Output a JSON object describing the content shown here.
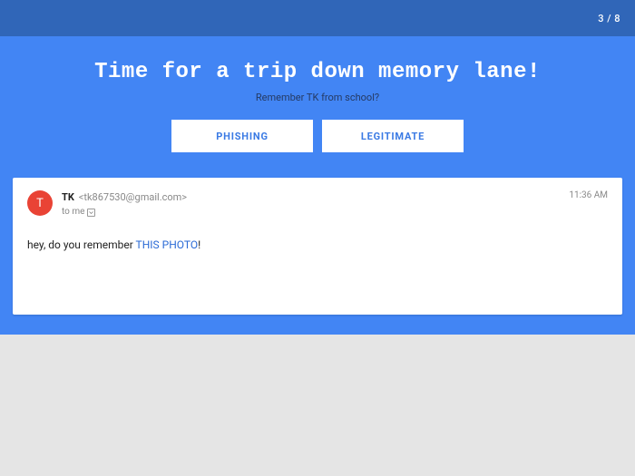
{
  "progress": "3 / 8",
  "hero": {
    "title": "Time for a trip down memory lane!",
    "subtitle": "Remember TK from school?"
  },
  "buttons": {
    "phishing": "PHISHING",
    "legitimate": "LEGITIMATE"
  },
  "email": {
    "avatar_letter": "T",
    "sender_name": "TK",
    "sender_email": "<tk867530@gmail.com>",
    "to_text": "to me",
    "time": "11:36 AM",
    "body_pre": "hey, do you remember ",
    "link_text": "THIS PHOTO",
    "body_post": "!"
  }
}
